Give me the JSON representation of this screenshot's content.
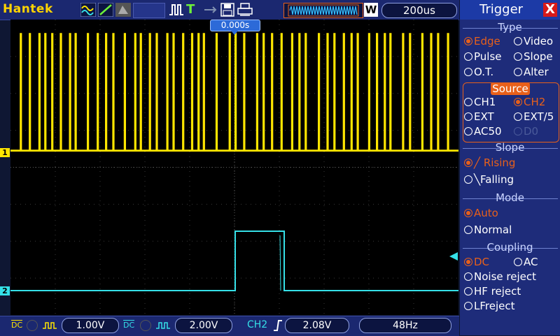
{
  "brand": "Hantek",
  "toolbar": {
    "trigger_level_t": "T",
    "timebase_mode": "W",
    "timebase": "200us"
  },
  "trigger_position": "0.000s",
  "channels": {
    "ch1": {
      "marker": "1",
      "color": "#ffe600",
      "coupling": "DC",
      "scale": "1.00V"
    },
    "ch2": {
      "marker": "2",
      "color": "#35e0e8",
      "coupling": "DC",
      "scale": "2.00V"
    }
  },
  "trigger_status": {
    "source": "CH2",
    "level": "2.08V",
    "frequency": "48Hz"
  },
  "sidebar": {
    "title": "Trigger",
    "close": "X",
    "type": {
      "heading": "Type",
      "options": [
        "Edge",
        "Video",
        "Pulse",
        "Slope",
        "O.T.",
        "Alter"
      ],
      "selected": "Edge"
    },
    "source": {
      "heading": "Source",
      "options": [
        "CH1",
        "CH2",
        "EXT",
        "EXT/5",
        "AC50",
        "D0"
      ],
      "selected": "CH2"
    },
    "slope": {
      "heading": "Slope",
      "options": [
        "Rising",
        "Falling"
      ],
      "selected": "Rising"
    },
    "mode": {
      "heading": "Mode",
      "options": [
        "Auto",
        "Normal"
      ],
      "selected": "Auto"
    },
    "coupling": {
      "heading": "Coupling",
      "options": [
        "DC",
        "AC",
        "Noise reject",
        "HF reject",
        "LFreject"
      ],
      "selected": "DC"
    }
  },
  "colors": {
    "accent": "#e8601a",
    "panel": "#1e2c7a",
    "ch1": "#ffe600",
    "ch2": "#35e0e8"
  }
}
